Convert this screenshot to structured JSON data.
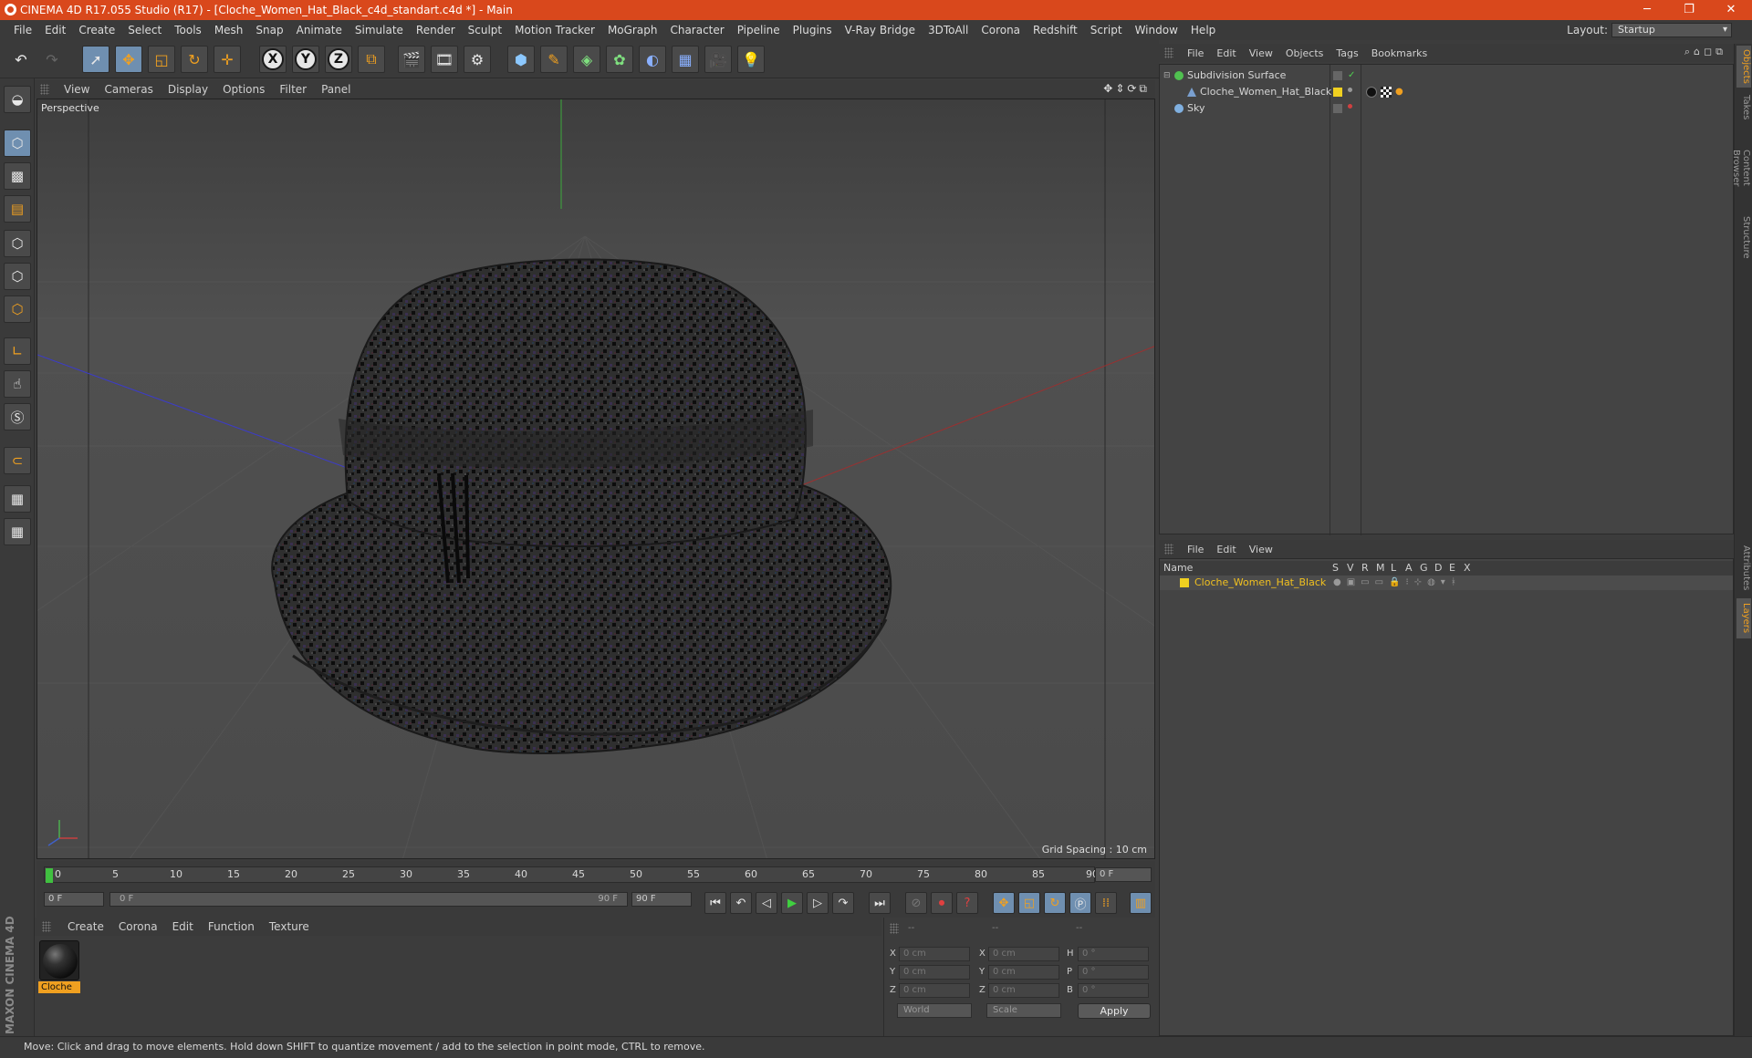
{
  "title": "CINEMA 4D R17.055 Studio (R17) - [Cloche_Women_Hat_Black_c4d_standart.c4d *] - Main",
  "menu": [
    "File",
    "Edit",
    "Create",
    "Select",
    "Tools",
    "Mesh",
    "Snap",
    "Animate",
    "Simulate",
    "Render",
    "Sculpt",
    "Motion Tracker",
    "MoGraph",
    "Character",
    "Pipeline",
    "Plugins",
    "V-Ray Bridge",
    "3DToAll",
    "Corona",
    "Redshift",
    "Script",
    "Window",
    "Help"
  ],
  "layout": {
    "label": "Layout:",
    "value": "Startup"
  },
  "viewport": {
    "menu": [
      "View",
      "Cameras",
      "Display",
      "Options",
      "Filter",
      "Panel"
    ],
    "label": "Perspective",
    "grid_spacing": "Grid Spacing : 10 cm"
  },
  "timeline": {
    "ticks": [
      "0",
      "5",
      "10",
      "15",
      "20",
      "25",
      "30",
      "35",
      "40",
      "45",
      "50",
      "55",
      "60",
      "65",
      "70",
      "75",
      "80",
      "85",
      "90"
    ],
    "current_frame": "0 F",
    "start": "0 F",
    "slider_start": "0 F",
    "slider_end": "90 F",
    "end": "90 F"
  },
  "material_manager": {
    "menu": [
      "Create",
      "Corona",
      "Edit",
      "Function",
      "Texture"
    ],
    "material_name": "Cloche"
  },
  "coordinates": {
    "headers": [
      "--",
      "--",
      "--"
    ],
    "rows": [
      {
        "a": "X",
        "av": "0 cm",
        "b": "X",
        "bv": "0 cm",
        "c": "H",
        "cv": "0 °"
      },
      {
        "a": "Y",
        "av": "0 cm",
        "b": "Y",
        "bv": "0 cm",
        "c": "P",
        "cv": "0 °"
      },
      {
        "a": "Z",
        "av": "0 cm",
        "b": "Z",
        "bv": "0 cm",
        "c": "B",
        "cv": "0 °"
      }
    ],
    "space": "World",
    "mode": "Scale",
    "apply": "Apply"
  },
  "objects_panel": {
    "menu": [
      "File",
      "Edit",
      "View",
      "Objects",
      "Tags",
      "Bookmarks"
    ],
    "items": [
      {
        "name": "Subdivision Surface"
      },
      {
        "name": "Cloche_Women_Hat_Black"
      },
      {
        "name": "Sky"
      }
    ]
  },
  "layers_panel": {
    "menu": [
      "File",
      "Edit",
      "View"
    ],
    "columns": [
      "Name",
      "S",
      "V",
      "R",
      "M",
      "L",
      "A",
      "G",
      "D",
      "E",
      "X"
    ],
    "layer": "Cloche_Women_Hat_Black"
  },
  "side_tabs": [
    "Objects",
    "Takes",
    "Content Browser",
    "Structure",
    "Attributes",
    "Layers"
  ],
  "status": "Move: Click and drag to move elements. Hold down SHIFT to quantize movement / add to the selection in point mode, CTRL to remove.",
  "logo_text": "MAXON CINEMA 4D",
  "colors": {
    "title_bar": "#d9481c",
    "accent": "#f0a020",
    "active_tool": "#6f8fb0",
    "layer_color": "#f0d020"
  }
}
